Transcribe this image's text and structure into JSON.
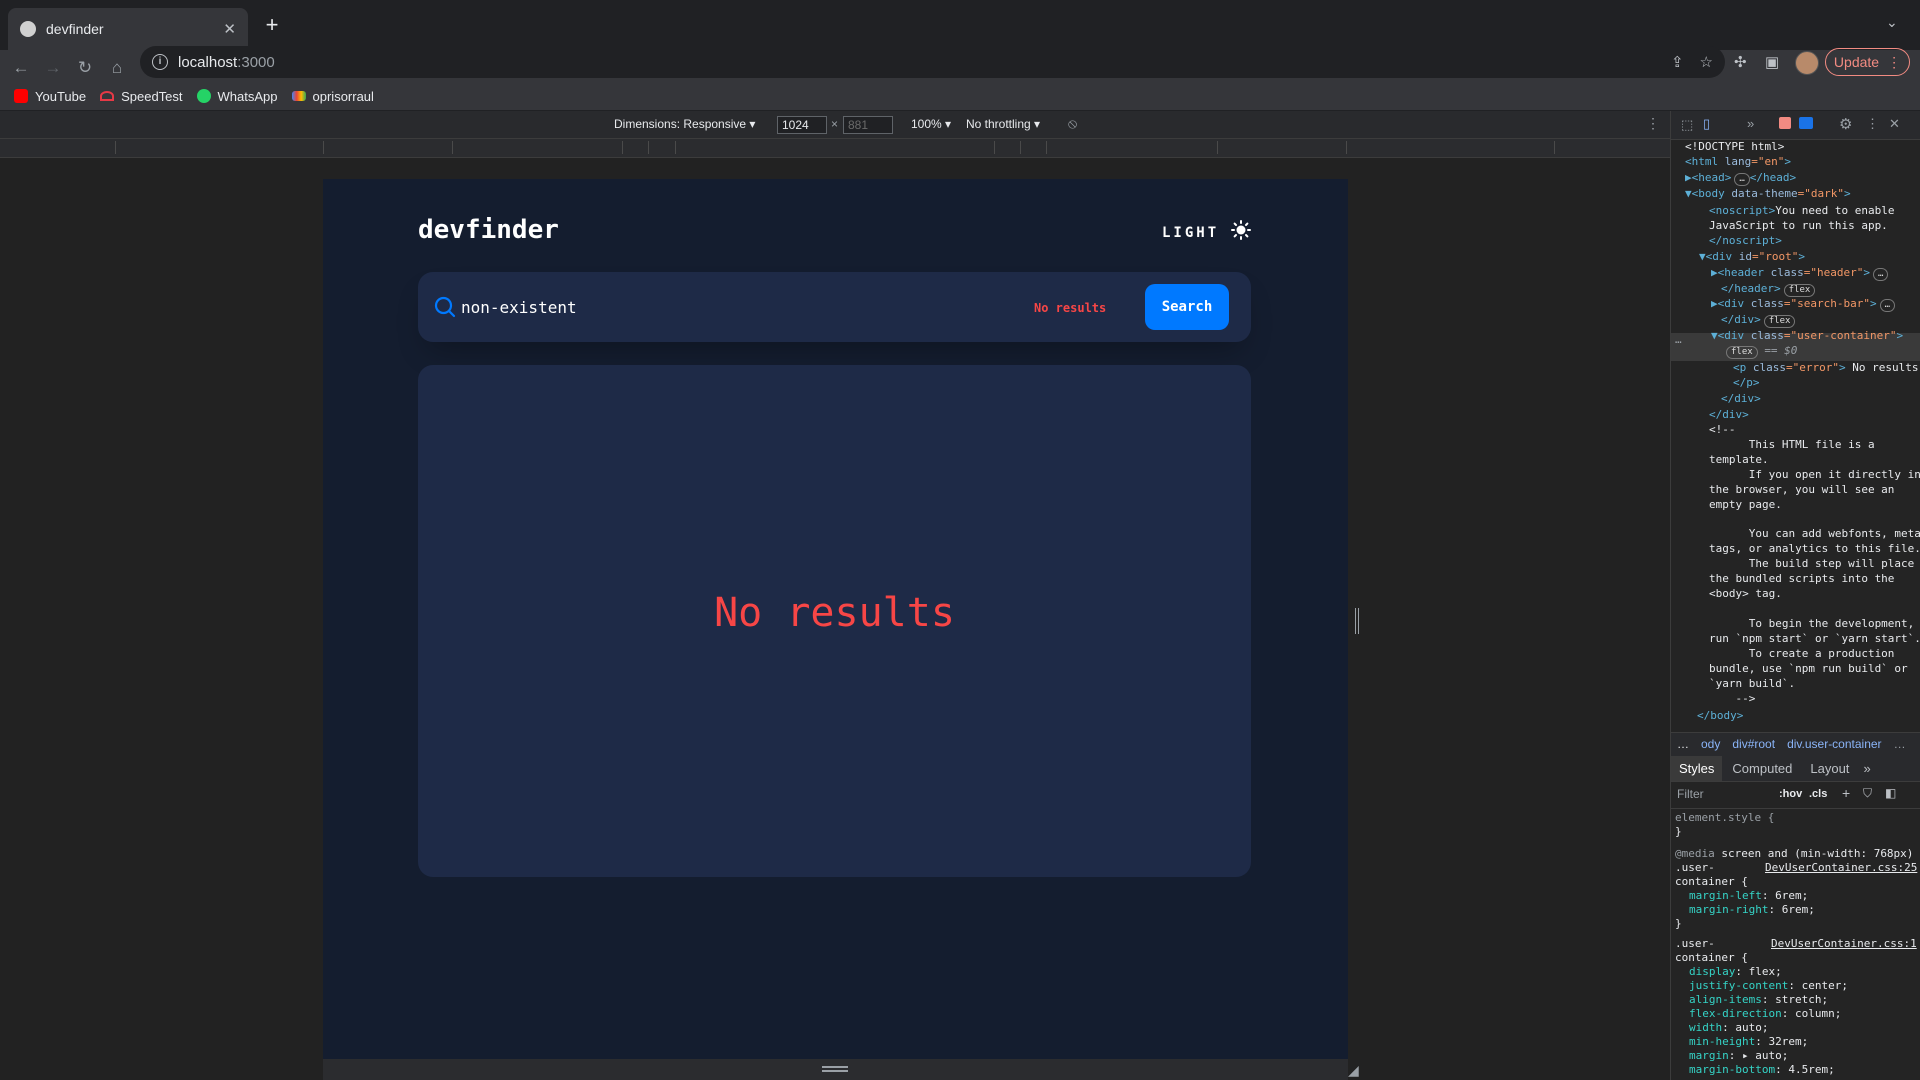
{
  "browser": {
    "tab_title": "devfinder",
    "url_host": "localhost",
    "url_port": ":3000",
    "update_label": "Update",
    "bookmarks": [
      "YouTube",
      "SpeedTest",
      "WhatsApp",
      "oprisorraul"
    ]
  },
  "device_toolbar": {
    "dimensions_label": "Dimensions: Responsive",
    "width_value": "1024",
    "times": "×",
    "height_placeholder": "881",
    "zoom": "100%",
    "throttling": "No throttling"
  },
  "app": {
    "logo": "devfinder",
    "theme_label": "LIGHT",
    "search_value": "non-existent",
    "search_error": "No results",
    "search_button": "Search",
    "error_message": "No results",
    "colors": {
      "bg": "#141d2f",
      "card": "#1e2a47",
      "accent": "#0079ff",
      "error": "#f74646"
    }
  },
  "devtools": {
    "elements": {
      "l0": "<!DOCTYPE html>",
      "l1a": "<html ",
      "l1b": "lang",
      "l1c": "=\"en\"",
      "l1d": ">",
      "l2a": "▶<head>",
      "l2b": "…",
      "l2c": "</head>",
      "l3a": "▼<body ",
      "l3b": "data-theme",
      "l3c": "=\"dark\"",
      "l3d": ">",
      "l4a": "<noscript>",
      "l4b": "You need to enable",
      "l5": "JavaScript to run this app.",
      "l6": "</noscript>",
      "l7a": "▼<div ",
      "l7b": "id",
      "l7c": "=\"root\"",
      "l7d": ">",
      "l8a": "▶<header ",
      "l8b": "class",
      "l8c": "=\"header\"",
      "l8d": ">",
      "l9": "</header>",
      "l10a": "▶<div ",
      "l10b": "class",
      "l10c": "=\"search-bar\"",
      "l10d": ">",
      "l11": "</div>",
      "l12a": "▼<div ",
      "l12b": "class",
      "l12c": "=\"user-container\"",
      "l12d": ">",
      "l13": "== $0",
      "l14a": "<p ",
      "l14b": "class",
      "l14c": "=\"error\"",
      "l14d": ">",
      "l14e": " No results",
      "l15": "</p>",
      "l16": "</div>",
      "l17": "</div>",
      "l18": "<!--",
      "l19": "      This HTML file is a",
      "l20": "template.",
      "l21": "      If you open it directly in",
      "l22": "the browser, you will see an",
      "l23": "empty page.",
      "l24": "      You can add webfonts, meta",
      "l25": "tags, or analytics to this file.",
      "l26": "      The build step will place",
      "l27": "the bundled scripts into the",
      "l28": "<body> tag.",
      "l29": "      To begin the development,",
      "l30": "run `npm start` or `yarn start`.",
      "l31": "      To create a production",
      "l32": "bundle, use `npm run build` or",
      "l33": "`yarn build`.",
      "l34": "    -->",
      "l35": "</body>",
      "badge": "flex",
      "ellipsis": "…"
    },
    "breadcrumbs": [
      "…",
      "ody",
      "div#root",
      "div.user-container",
      "…"
    ],
    "style_tabs": [
      "Styles",
      "Computed",
      "Layout",
      "»"
    ],
    "filter_placeholder": "Filter",
    "hov": ":hov",
    "cls": ".cls",
    "styles": {
      "s0": "element.style {",
      "s1": "}",
      "s2a": "@media",
      "s2b": " screen and (min-width: 768px)",
      "s3a": ".user-",
      "s3b": "DevUserContainer.css:25",
      "s4": "container {",
      "s5a": "margin-left",
      "s5b": ": 6rem;",
      "s6a": "margin-right",
      "s6b": ": 6rem;",
      "s7": "}",
      "s8a": ".user-",
      "s8b": "DevUserContainer.css:1",
      "s9": "container {",
      "s10a": "display",
      "s10b": ": flex;",
      "s11a": "justify-content",
      "s11b": ": center;",
      "s12a": "align-items",
      "s12b": ": stretch;",
      "s13a": "flex-direction",
      "s13b": ": column;",
      "s14a": "width",
      "s14b": ": auto;",
      "s15a": "min-height",
      "s15b": ": 32rem;",
      "s16a": "margin",
      "s16b": ": ▸ auto;",
      "s17a": "margin-bottom",
      "s17b": ": 4.5rem;"
    }
  }
}
